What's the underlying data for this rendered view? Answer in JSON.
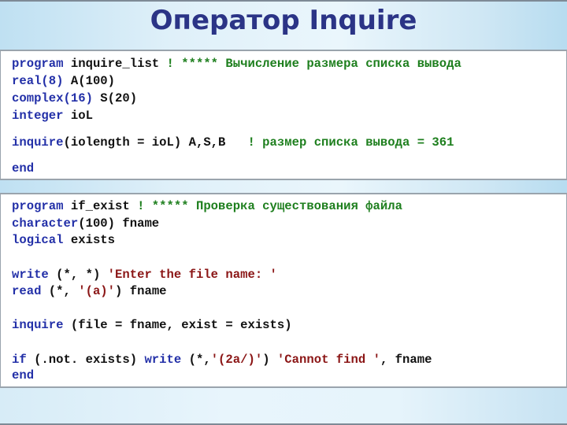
{
  "slide": {
    "title": "Оператор Inquire"
  },
  "colors": {
    "title": "#2b3486",
    "keyword": "#2330a8",
    "comment": "#1e7f1e",
    "string": "#8b1616",
    "text": "#111111"
  },
  "code_block_1": {
    "lines": [
      {
        "kw": "program",
        "tx": " inquire_list ",
        "cm": "! ***** Вычисление размера списка вывода"
      },
      {
        "kw": "real(8)",
        "tx": " A(100)"
      },
      {
        "kw": "complex(16)",
        "tx": " S(20)"
      },
      {
        "kw": "integer",
        "tx": " ioL"
      },
      {
        "kw": "inquire",
        "tx": "(iolength = ioL) A,S,B   ",
        "cm": "! размер списка вывода = 361"
      },
      {
        "kw": "end"
      }
    ]
  },
  "code_block_2": {
    "lines": [
      {
        "kw": "program",
        "tx": " if_exist ",
        "cm": "! ***** Проверка существования файла"
      },
      {
        "kw": "character",
        "tx": "(100) fname"
      },
      {
        "kw": "logical",
        "tx": " exists"
      },
      {
        "kw": "write",
        "tx": " (*, *) ",
        "st": "'Enter the file name: '"
      },
      {
        "kw": "read",
        "tx": " (*, ",
        "st": "'(a)'",
        "tx2": ") fname"
      },
      {
        "kw": "inquire",
        "tx": " (file = fname, exist = exists)"
      },
      {
        "kw": "if",
        "tx": " (.not. exists) ",
        "kw2": "write",
        "tx2": " (*,",
        "st": "'(2a/)'",
        "tx3": ") ",
        "st2": "'Cannot find '",
        "tx4": ", fname"
      },
      {
        "kw": "end"
      }
    ]
  }
}
